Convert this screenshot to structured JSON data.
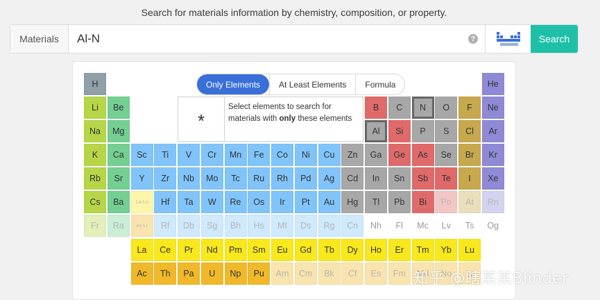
{
  "tagline": "Search for materials information by chemistry, composition, or property.",
  "search": {
    "label": "Materials",
    "value": "Al-N",
    "help": "?",
    "button": "Search"
  },
  "tabs": [
    {
      "label": "Only Elements",
      "active": true
    },
    {
      "label": "At Least Elements",
      "active": false
    },
    {
      "label": "Formula",
      "active": false
    }
  ],
  "info": {
    "symbol": "*",
    "text_pre": "Select elements to search for materials with ",
    "text_bold": "only",
    "text_post": " these elements"
  },
  "colors": {
    "teal_button": "#1ec0a8",
    "active_tab": "#3a6fd8",
    "hydrogen": "#8fa0a8",
    "alkali": "#b6d648",
    "alkaline_earth": "#74cf92",
    "transition": "#80c4fa",
    "post_transition": "#a7a7a7",
    "metalloid": "#e06a6a",
    "nonmetal": "#a7a7a7",
    "halogen": "#c7a84d",
    "noble": "#8e8ad6",
    "lanthanide": "#f9e81c",
    "actinide": "#f0b92a"
  },
  "elements": [
    {
      "s": "H",
      "r": 1,
      "c": 1,
      "k": "hydrogen"
    },
    {
      "s": "He",
      "r": 1,
      "c": 18,
      "k": "noble"
    },
    {
      "s": "Li",
      "r": 2,
      "c": 1,
      "k": "alkali"
    },
    {
      "s": "Be",
      "r": 2,
      "c": 2,
      "k": "alkaline_earth"
    },
    {
      "s": "B",
      "r": 2,
      "c": 13,
      "k": "metalloid"
    },
    {
      "s": "C",
      "r": 2,
      "c": 14,
      "k": "nonmetal"
    },
    {
      "s": "N",
      "r": 2,
      "c": 15,
      "k": "nonmetal",
      "sel": true
    },
    {
      "s": "O",
      "r": 2,
      "c": 16,
      "k": "nonmetal"
    },
    {
      "s": "F",
      "r": 2,
      "c": 17,
      "k": "halogen"
    },
    {
      "s": "Ne",
      "r": 2,
      "c": 18,
      "k": "noble"
    },
    {
      "s": "Na",
      "r": 3,
      "c": 1,
      "k": "alkali"
    },
    {
      "s": "Mg",
      "r": 3,
      "c": 2,
      "k": "alkaline_earth"
    },
    {
      "s": "Al",
      "r": 3,
      "c": 13,
      "k": "post_transition",
      "sel": true
    },
    {
      "s": "Si",
      "r": 3,
      "c": 14,
      "k": "metalloid"
    },
    {
      "s": "P",
      "r": 3,
      "c": 15,
      "k": "nonmetal"
    },
    {
      "s": "S",
      "r": 3,
      "c": 16,
      "k": "nonmetal"
    },
    {
      "s": "Cl",
      "r": 3,
      "c": 17,
      "k": "halogen"
    },
    {
      "s": "Ar",
      "r": 3,
      "c": 18,
      "k": "noble"
    },
    {
      "s": "K",
      "r": 4,
      "c": 1,
      "k": "alkali"
    },
    {
      "s": "Ca",
      "r": 4,
      "c": 2,
      "k": "alkaline_earth"
    },
    {
      "s": "Sc",
      "r": 4,
      "c": 3,
      "k": "transition"
    },
    {
      "s": "Ti",
      "r": 4,
      "c": 4,
      "k": "transition"
    },
    {
      "s": "V",
      "r": 4,
      "c": 5,
      "k": "transition"
    },
    {
      "s": "Cr",
      "r": 4,
      "c": 6,
      "k": "transition"
    },
    {
      "s": "Mn",
      "r": 4,
      "c": 7,
      "k": "transition"
    },
    {
      "s": "Fe",
      "r": 4,
      "c": 8,
      "k": "transition"
    },
    {
      "s": "Co",
      "r": 4,
      "c": 9,
      "k": "transition"
    },
    {
      "s": "Ni",
      "r": 4,
      "c": 10,
      "k": "transition"
    },
    {
      "s": "Cu",
      "r": 4,
      "c": 11,
      "k": "transition"
    },
    {
      "s": "Zn",
      "r": 4,
      "c": 12,
      "k": "post_transition"
    },
    {
      "s": "Ga",
      "r": 4,
      "c": 13,
      "k": "post_transition"
    },
    {
      "s": "Ge",
      "r": 4,
      "c": 14,
      "k": "metalloid"
    },
    {
      "s": "As",
      "r": 4,
      "c": 15,
      "k": "metalloid"
    },
    {
      "s": "Se",
      "r": 4,
      "c": 16,
      "k": "nonmetal"
    },
    {
      "s": "Br",
      "r": 4,
      "c": 17,
      "k": "halogen"
    },
    {
      "s": "Kr",
      "r": 4,
      "c": 18,
      "k": "noble"
    },
    {
      "s": "Rb",
      "r": 5,
      "c": 1,
      "k": "alkali"
    },
    {
      "s": "Sr",
      "r": 5,
      "c": 2,
      "k": "alkaline_earth"
    },
    {
      "s": "Y",
      "r": 5,
      "c": 3,
      "k": "transition"
    },
    {
      "s": "Zr",
      "r": 5,
      "c": 4,
      "k": "transition"
    },
    {
      "s": "Nb",
      "r": 5,
      "c": 5,
      "k": "transition"
    },
    {
      "s": "Mo",
      "r": 5,
      "c": 6,
      "k": "transition"
    },
    {
      "s": "Tc",
      "r": 5,
      "c": 7,
      "k": "transition"
    },
    {
      "s": "Ru",
      "r": 5,
      "c": 8,
      "k": "transition"
    },
    {
      "s": "Rh",
      "r": 5,
      "c": 9,
      "k": "transition"
    },
    {
      "s": "Pd",
      "r": 5,
      "c": 10,
      "k": "transition"
    },
    {
      "s": "Ag",
      "r": 5,
      "c": 11,
      "k": "transition"
    },
    {
      "s": "Cd",
      "r": 5,
      "c": 12,
      "k": "post_transition"
    },
    {
      "s": "In",
      "r": 5,
      "c": 13,
      "k": "post_transition"
    },
    {
      "s": "Sn",
      "r": 5,
      "c": 14,
      "k": "post_transition"
    },
    {
      "s": "Sb",
      "r": 5,
      "c": 15,
      "k": "metalloid"
    },
    {
      "s": "Te",
      "r": 5,
      "c": 16,
      "k": "metalloid"
    },
    {
      "s": "I",
      "r": 5,
      "c": 17,
      "k": "halogen"
    },
    {
      "s": "Xe",
      "r": 5,
      "c": 18,
      "k": "noble"
    },
    {
      "s": "Cs",
      "r": 6,
      "c": 1,
      "k": "alkali"
    },
    {
      "s": "Ba",
      "r": 6,
      "c": 2,
      "k": "alkaline_earth"
    },
    {
      "s": "La-Lu",
      "r": 6,
      "c": 3,
      "k": "lanthanide",
      "faded": true,
      "tiny": true
    },
    {
      "s": "Hf",
      "r": 6,
      "c": 4,
      "k": "transition"
    },
    {
      "s": "Ta",
      "r": 6,
      "c": 5,
      "k": "transition"
    },
    {
      "s": "W",
      "r": 6,
      "c": 6,
      "k": "transition"
    },
    {
      "s": "Re",
      "r": 6,
      "c": 7,
      "k": "transition"
    },
    {
      "s": "Os",
      "r": 6,
      "c": 8,
      "k": "transition"
    },
    {
      "s": "Ir",
      "r": 6,
      "c": 9,
      "k": "transition"
    },
    {
      "s": "Pt",
      "r": 6,
      "c": 10,
      "k": "transition"
    },
    {
      "s": "Au",
      "r": 6,
      "c": 11,
      "k": "transition"
    },
    {
      "s": "Hg",
      "r": 6,
      "c": 12,
      "k": "post_transition"
    },
    {
      "s": "Tl",
      "r": 6,
      "c": 13,
      "k": "post_transition"
    },
    {
      "s": "Pb",
      "r": 6,
      "c": 14,
      "k": "post_transition"
    },
    {
      "s": "Bi",
      "r": 6,
      "c": 15,
      "k": "metalloid"
    },
    {
      "s": "Po",
      "r": 6,
      "c": 16,
      "k": "metalloid",
      "faded": true
    },
    {
      "s": "At",
      "r": 6,
      "c": 17,
      "k": "halogen",
      "faded": true
    },
    {
      "s": "Rn",
      "r": 6,
      "c": 18,
      "k": "noble",
      "faded": true
    },
    {
      "s": "Fr",
      "r": 7,
      "c": 1,
      "k": "alkali",
      "faded": true
    },
    {
      "s": "Ra",
      "r": 7,
      "c": 2,
      "k": "alkaline_earth",
      "faded": true
    },
    {
      "s": "Ac-Lr",
      "r": 7,
      "c": 3,
      "k": "actinide",
      "faded": true,
      "tiny": true
    },
    {
      "s": "Rf",
      "r": 7,
      "c": 4,
      "k": "transition",
      "faded": true
    },
    {
      "s": "Db",
      "r": 7,
      "c": 5,
      "k": "transition",
      "faded": true
    },
    {
      "s": "Sg",
      "r": 7,
      "c": 6,
      "k": "transition",
      "faded": true
    },
    {
      "s": "Bh",
      "r": 7,
      "c": 7,
      "k": "transition",
      "faded": true
    },
    {
      "s": "Hs",
      "r": 7,
      "c": 8,
      "k": "transition",
      "faded": true
    },
    {
      "s": "Mt",
      "r": 7,
      "c": 9,
      "k": "transition",
      "faded": true
    },
    {
      "s": "Ds",
      "r": 7,
      "c": 10,
      "k": "transition",
      "faded": true
    },
    {
      "s": "Rg",
      "r": 7,
      "c": 11,
      "k": "transition",
      "faded": true
    },
    {
      "s": "Cn",
      "r": 7,
      "c": 12,
      "k": "transition",
      "faded": true
    },
    {
      "s": "Nh",
      "r": 7,
      "c": 13,
      "k": "blank"
    },
    {
      "s": "Fl",
      "r": 7,
      "c": 14,
      "k": "blank"
    },
    {
      "s": "Mc",
      "r": 7,
      "c": 15,
      "k": "blank"
    },
    {
      "s": "Lv",
      "r": 7,
      "c": 16,
      "k": "blank"
    },
    {
      "s": "Ts",
      "r": 7,
      "c": 17,
      "k": "blank"
    },
    {
      "s": "Og",
      "r": 7,
      "c": 18,
      "k": "blank"
    },
    {
      "s": "La",
      "r": 8,
      "c": 3,
      "k": "lanthanide"
    },
    {
      "s": "Ce",
      "r": 8,
      "c": 4,
      "k": "lanthanide"
    },
    {
      "s": "Pr",
      "r": 8,
      "c": 5,
      "k": "lanthanide"
    },
    {
      "s": "Nd",
      "r": 8,
      "c": 6,
      "k": "lanthanide"
    },
    {
      "s": "Pm",
      "r": 8,
      "c": 7,
      "k": "lanthanide"
    },
    {
      "s": "Sm",
      "r": 8,
      "c": 8,
      "k": "lanthanide"
    },
    {
      "s": "Eu",
      "r": 8,
      "c": 9,
      "k": "lanthanide"
    },
    {
      "s": "Gd",
      "r": 8,
      "c": 10,
      "k": "lanthanide"
    },
    {
      "s": "Tb",
      "r": 8,
      "c": 11,
      "k": "lanthanide"
    },
    {
      "s": "Dy",
      "r": 8,
      "c": 12,
      "k": "lanthanide"
    },
    {
      "s": "Ho",
      "r": 8,
      "c": 13,
      "k": "lanthanide"
    },
    {
      "s": "Er",
      "r": 8,
      "c": 14,
      "k": "lanthanide"
    },
    {
      "s": "Tm",
      "r": 8,
      "c": 15,
      "k": "lanthanide"
    },
    {
      "s": "Yb",
      "r": 8,
      "c": 16,
      "k": "lanthanide"
    },
    {
      "s": "Lu",
      "r": 8,
      "c": 17,
      "k": "lanthanide"
    },
    {
      "s": "Ac",
      "r": 9,
      "c": 3,
      "k": "actinide"
    },
    {
      "s": "Th",
      "r": 9,
      "c": 4,
      "k": "actinide"
    },
    {
      "s": "Pa",
      "r": 9,
      "c": 5,
      "k": "actinide"
    },
    {
      "s": "U",
      "r": 9,
      "c": 6,
      "k": "actinide"
    },
    {
      "s": "Np",
      "r": 9,
      "c": 7,
      "k": "actinide"
    },
    {
      "s": "Pu",
      "r": 9,
      "c": 8,
      "k": "actinide"
    },
    {
      "s": "Am",
      "r": 9,
      "c": 9,
      "k": "actinide",
      "faded": true
    },
    {
      "s": "Cm",
      "r": 9,
      "c": 10,
      "k": "actinide",
      "faded": true
    },
    {
      "s": "Bk",
      "r": 9,
      "c": 11,
      "k": "actinide",
      "faded": true
    },
    {
      "s": "Cf",
      "r": 9,
      "c": 12,
      "k": "actinide",
      "faded": true
    },
    {
      "s": "Es",
      "r": 9,
      "c": 13,
      "k": "actinide",
      "faded": true
    },
    {
      "s": "Fm",
      "r": 9,
      "c": 14,
      "k": "actinide",
      "faded": true
    },
    {
      "s": "Md",
      "r": 9,
      "c": 15,
      "k": "actinide",
      "faded": true
    },
    {
      "s": "No",
      "r": 9,
      "c": 16,
      "k": "actinide",
      "faded": true
    },
    {
      "s": "Lr",
      "r": 9,
      "c": 17,
      "k": "actinide",
      "faded": true
    }
  ],
  "watermark": "知乎 @瞎某某Blinder"
}
